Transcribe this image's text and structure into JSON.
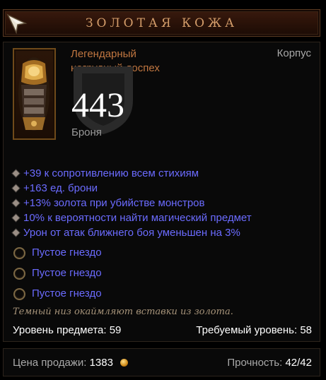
{
  "tooltip": {
    "name": "ЗОЛОТАЯ КОЖА",
    "rarity_line1": "Легендарный",
    "rarity_line2": "нагрудный доспех",
    "slot": "Корпус",
    "armor_value": "443",
    "armor_label": "Броня",
    "affixes": [
      "+39 к сопротивлению всем стихиям",
      "+163 ед. брони",
      "+13% золота при убийстве монстров",
      "10% к вероятности найти магический предмет",
      "Урон от атак ближнего боя уменьшен на 3%"
    ],
    "sockets": [
      "Пустое гнездо",
      "Пустое гнездо",
      "Пустое гнездо"
    ],
    "flavor": "Темный низ окаймляют вставки из золота.",
    "item_level_label": "Уровень предмета:",
    "item_level": "59",
    "required_level_label": "Требуемый уровень:",
    "required_level": "58",
    "sell_label": "Цена продажи:",
    "sell_value": "1383",
    "durability_label": "Прочность:",
    "durability_value": "42/42"
  },
  "icons": {
    "corner": "arrow-cursor-icon",
    "item": "chest-armor-icon",
    "armor": "shield-icon",
    "affix_bullet": "diamond-bullet-icon",
    "socket": "empty-socket-icon",
    "gold": "gold-coin-icon"
  },
  "colors": {
    "title": "#d49d6a",
    "legendary": "#c07640",
    "magic_affix": "#6b6bff",
    "flavor": "#a7947a",
    "label_gray": "#a9a9a9",
    "white": "#ffffff"
  }
}
